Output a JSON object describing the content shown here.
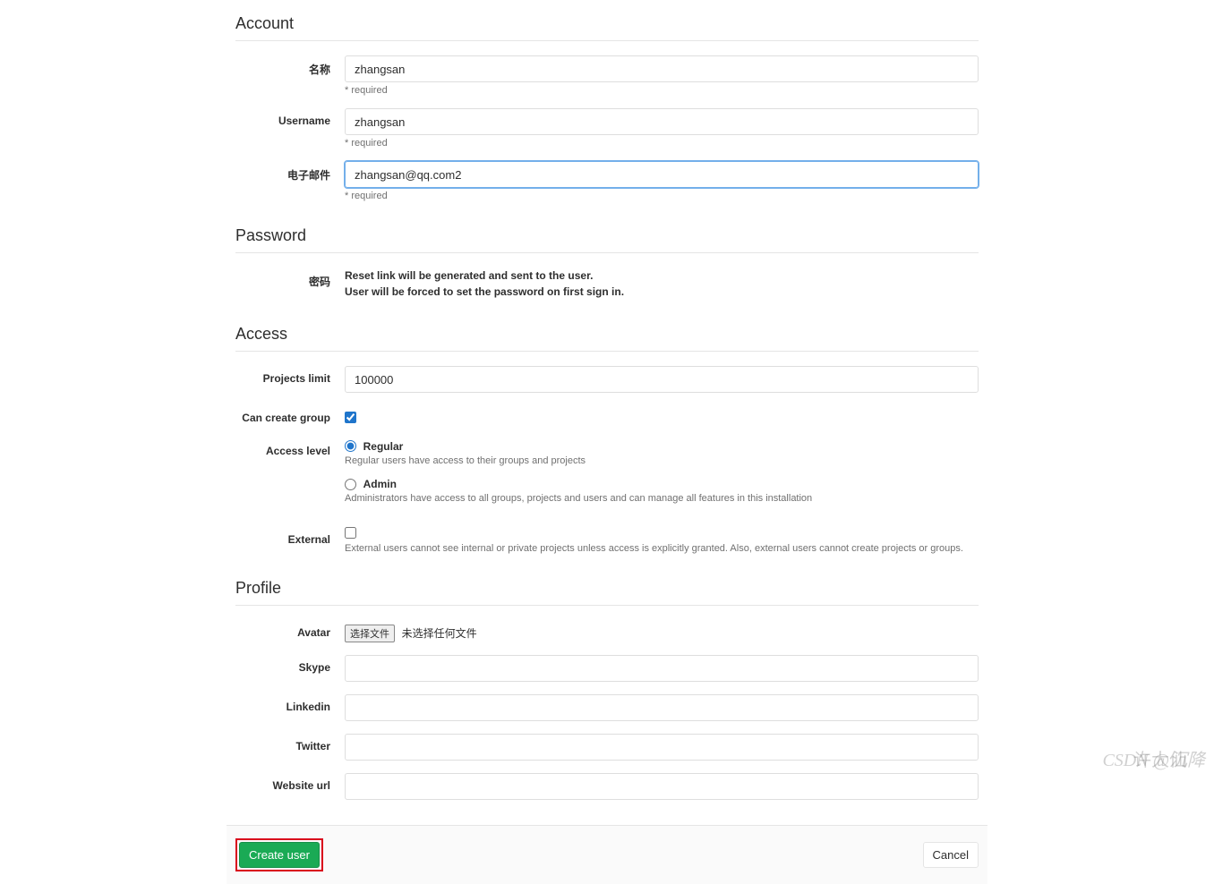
{
  "sections": {
    "account": {
      "title": "Account",
      "name": {
        "label": "名称",
        "value": "zhangsan",
        "required": "* required"
      },
      "username": {
        "label": "Username",
        "value": "zhangsan",
        "required": "* required"
      },
      "email": {
        "label": "电子邮件",
        "value": "zhangsan@qq.com2",
        "required": "* required"
      }
    },
    "password": {
      "title": "Password",
      "label": "密码",
      "info_line1": "Reset link will be generated and sent to the user.",
      "info_line2": "User will be forced to set the password on first sign in."
    },
    "access": {
      "title": "Access",
      "projects_limit": {
        "label": "Projects limit",
        "value": "100000"
      },
      "can_create_group": {
        "label": "Can create group",
        "checked": true
      },
      "access_level": {
        "label": "Access level",
        "regular": {
          "label": "Regular",
          "help": "Regular users have access to their groups and projects"
        },
        "admin": {
          "label": "Admin",
          "help": "Administrators have access to all groups, projects and users and can manage all features in this installation"
        }
      },
      "external": {
        "label": "External",
        "help": "External users cannot see internal or private projects unless access is explicitly granted. Also, external users cannot create projects or groups."
      }
    },
    "profile": {
      "title": "Profile",
      "avatar": {
        "label": "Avatar",
        "button": "选择文件",
        "status": "未选择任何文件"
      },
      "skype": {
        "label": "Skype"
      },
      "linkedin": {
        "label": "Linkedin"
      },
      "twitter": {
        "label": "Twitter"
      },
      "website": {
        "label": "Website url"
      }
    }
  },
  "buttons": {
    "submit": "Create user",
    "cancel": "Cancel"
  },
  "watermark": {
    "a": "许大仙",
    "b": "CSDN @沉降"
  }
}
